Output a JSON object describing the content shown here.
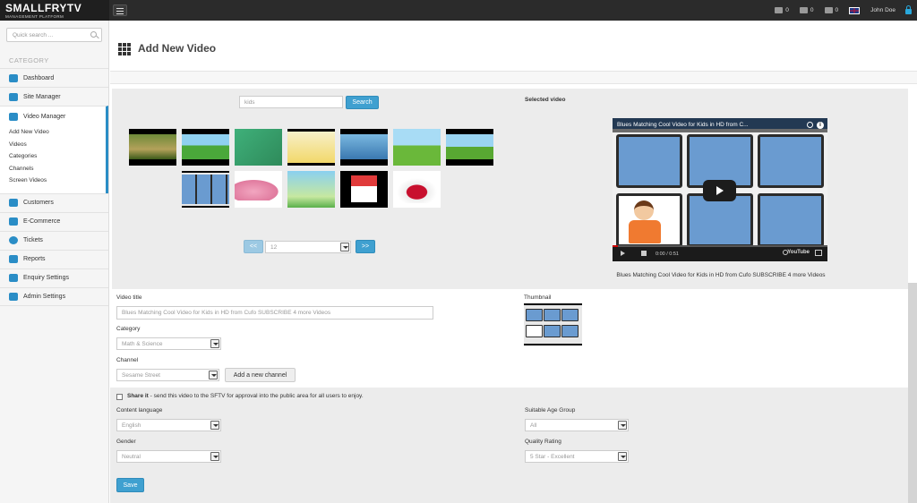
{
  "brand": {
    "name": "SMALLFRYTV",
    "subtitle": "MANAGEMENT PLATFORM"
  },
  "topbar": {
    "messages_count": "0",
    "cart_count": "0",
    "tasks_count": "0",
    "user_name": "John Doe"
  },
  "sidebar": {
    "search_placeholder": "Quick search ...",
    "category_label": "CATEGORY",
    "items": [
      {
        "label": "Dashboard",
        "icon": "home-icon"
      },
      {
        "label": "Site Manager",
        "icon": "site-manager-icon"
      },
      {
        "label": "Video Manager",
        "icon": "video-manager-icon",
        "active": true,
        "sub": [
          "Add New Video",
          "Videos",
          "Categories",
          "Channels",
          "Screen Videos"
        ]
      },
      {
        "label": "Customers",
        "icon": "customers-icon"
      },
      {
        "label": "E-Commerce",
        "icon": "cart-icon"
      },
      {
        "label": "Tickets",
        "icon": "tickets-icon"
      },
      {
        "label": "Reports",
        "icon": "reports-icon"
      },
      {
        "label": "Enquiry Settings",
        "icon": "enquiry-icon"
      },
      {
        "label": "Admin Settings",
        "icon": "admin-icon"
      }
    ]
  },
  "page": {
    "title": "Add New Video"
  },
  "picker": {
    "keyword_value": "kids",
    "search_label": "Search",
    "selected_label": "Selected video",
    "prev_label": "<<",
    "next_label": ">>",
    "page_value": "12"
  },
  "player": {
    "title": "Blues Matching Cool Video for Kids in HD from C...",
    "time": "0:00 / 0:51",
    "yt_logo": "YouTube",
    "caption": "Blues Matching Cool Video for Kids in HD from Cufo SUBSCRIBE 4 more Videos"
  },
  "form": {
    "video_title_label": "Video title",
    "video_title_value": "Blues Matching Cool Video for Kids in HD from Cufo SUBSCRIBE 4 more Videos",
    "thumbnail_label": "Thumbnail",
    "category_label": "Category",
    "category_value": "Math & Science",
    "channel_label": "Channel",
    "channel_value": "Sesame Street",
    "add_channel_label": "Add a new channel",
    "share_bold": "Share it",
    "share_text": " - send this video to the SFTV for approval into the public area for all users to enjoy.",
    "content_language_label": "Content language",
    "content_language_value": "English",
    "age_group_label": "Suitable Age Group",
    "age_group_value": "All",
    "gender_label": "Gender",
    "gender_value": "Neutral",
    "quality_label": "Quality Rating",
    "quality_value": "5 Star - Excellent",
    "save_label": "Save"
  },
  "colors": {
    "accent": "#3fa0d0",
    "topbar": "#2b2b2b",
    "sidebar_icon": "#2a8dc6"
  }
}
